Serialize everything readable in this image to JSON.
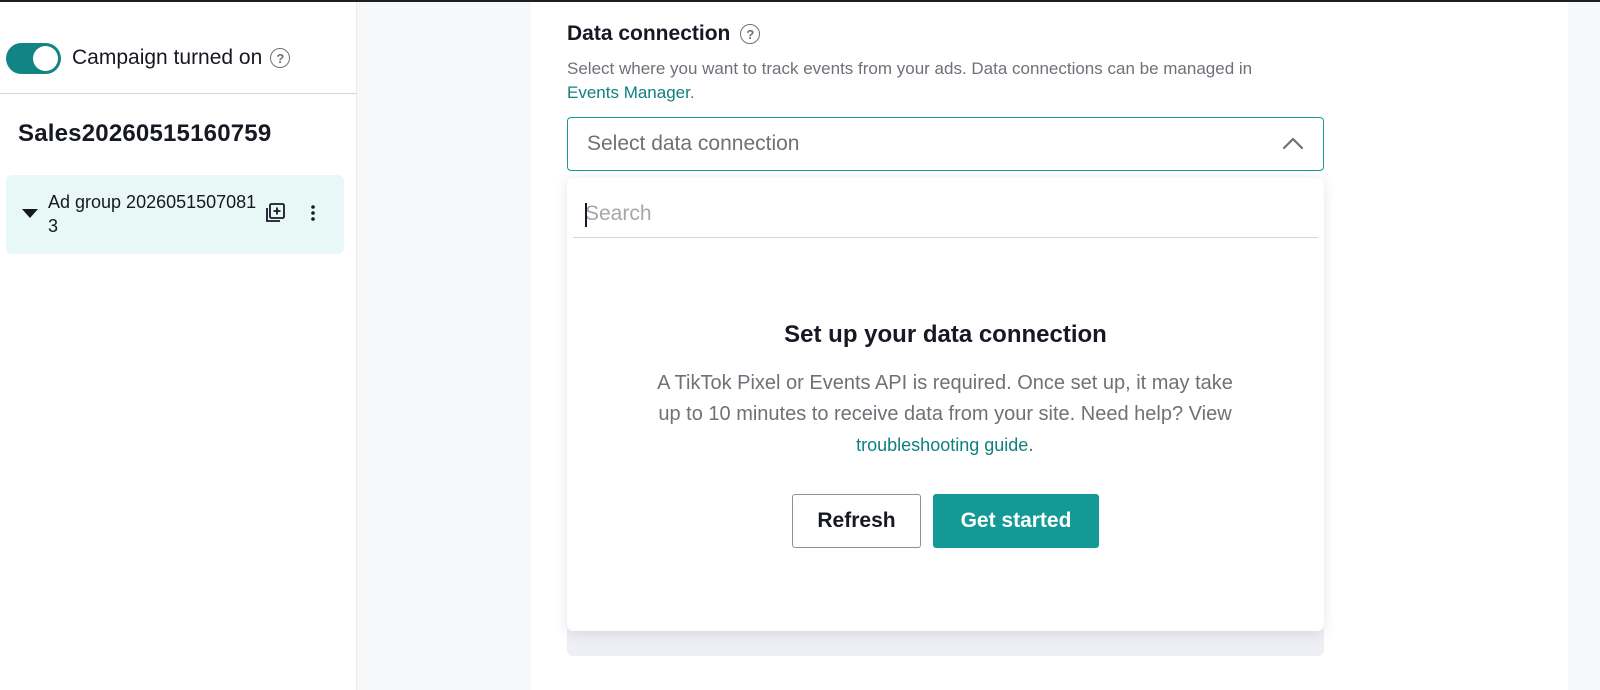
{
  "sidebar": {
    "toggle_label": "Campaign turned on",
    "toggle_on": true,
    "campaign_name": "Sales20260515160759",
    "ad_group": {
      "name": "Ad group 20260515070813"
    }
  },
  "data_connection": {
    "title": "Data connection",
    "desc_prefix": "Select where you want to track events from your ads. Data connections can be managed in ",
    "desc_link": "Events Manager",
    "desc_suffix": ".",
    "select_placeholder": "Select data connection"
  },
  "dropdown": {
    "search_placeholder": "Search",
    "empty_title": "Set up your data connection",
    "empty_desc_prefix": "A TikTok Pixel or Events API is required. Once set up, it may take up to 10 minutes to receive data from your site. Need help? View ",
    "empty_desc_link": "troubleshooting guide",
    "empty_desc_suffix": ".",
    "refresh_label": "Refresh",
    "get_started_label": "Get started"
  },
  "colors": {
    "accent": "#139a97",
    "link": "#0f7f7f",
    "toggle": "#138484",
    "selected_bg": "#e7f8f7"
  },
  "icons": {
    "help": "question-circle-icon",
    "caret": "caret-down-icon",
    "copy": "duplicate-icon",
    "more": "more-vertical-icon",
    "chevron": "chevron-up-icon"
  }
}
